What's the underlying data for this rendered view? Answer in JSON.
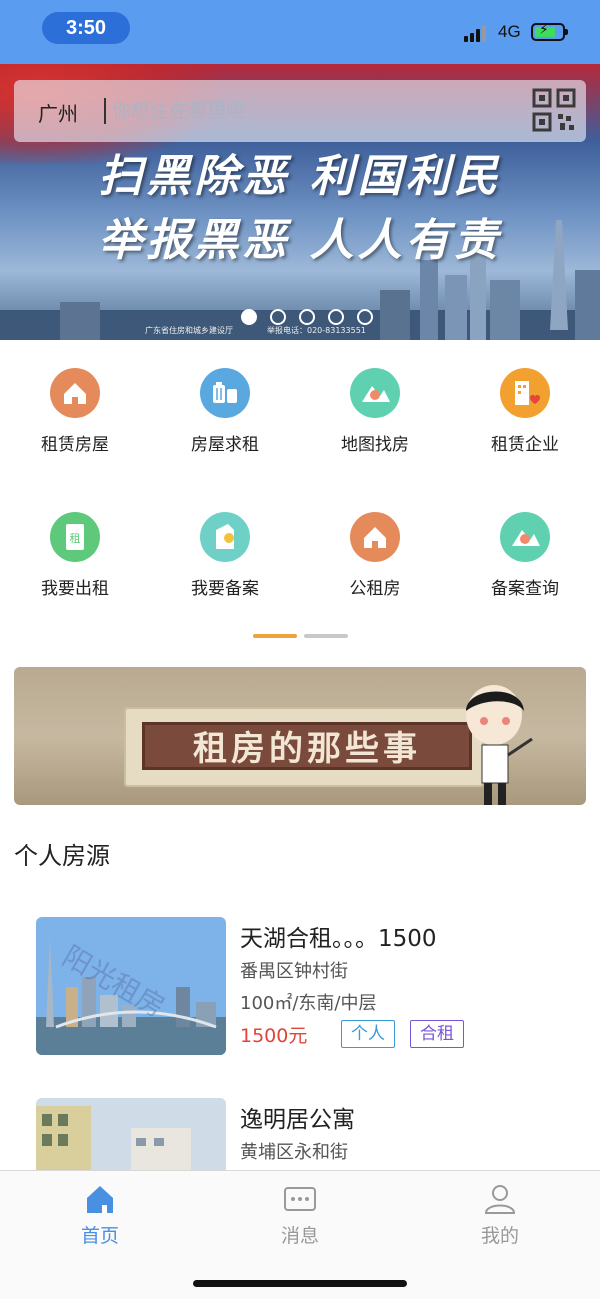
{
  "status_bar": {
    "time": "3:50",
    "network": "4G"
  },
  "banner": {
    "slogan_line1": "扫黑除恶 利国利民",
    "slogan_line2": "举报黑恶 人人有责",
    "footer_left": "广东省住房和城乡建设厅",
    "footer_right": "举报电话：020-83133551",
    "slide_count": 5,
    "active_slide": 1
  },
  "search": {
    "city": "广州",
    "placeholder": "你想住在哪里呢"
  },
  "grid": {
    "items": [
      {
        "label": "租赁房屋",
        "icon": "house-icon",
        "color": "#e58a5a"
      },
      {
        "label": "房屋求租",
        "icon": "luggage-icon",
        "color": "#5aa8e0"
      },
      {
        "label": "地图找房",
        "icon": "map-icon",
        "color": "#5fd0b0"
      },
      {
        "label": "租赁企业",
        "icon": "enterprise-icon",
        "color": "#f2a02f"
      },
      {
        "label": "我要出租",
        "icon": "rent-out-icon",
        "color": "#5ec97a"
      },
      {
        "label": "我要备案",
        "icon": "record-icon",
        "color": "#6fd0c8"
      },
      {
        "label": "公租房",
        "icon": "public-housing-icon",
        "color": "#e58a5a"
      },
      {
        "label": "备案查询",
        "icon": "record-query-icon",
        "color": "#5fd0b0"
      }
    ],
    "pages": 2,
    "active_page": 1,
    "accent": "#f0a23a"
  },
  "promo": {
    "title": "租房的那些事"
  },
  "section": {
    "title": "个人房源"
  },
  "listings": [
    {
      "name": "天湖合租。。。1500",
      "area": "番禺区钟村街",
      "spec": "100㎡/东南/中层",
      "price": "1500元",
      "tags": [
        "个人",
        "合租"
      ],
      "watermark": "阳光租房"
    },
    {
      "name": "逸明居公寓",
      "area": "黄埔区永和街"
    }
  ],
  "tabbar": {
    "tabs": [
      {
        "label": "首页",
        "icon": "home-icon",
        "active": true
      },
      {
        "label": "消息",
        "icon": "message-icon",
        "active": false
      },
      {
        "label": "我的",
        "icon": "profile-icon",
        "active": false
      }
    ],
    "active_color": "#4a90e2",
    "inactive_color": "#999999"
  }
}
